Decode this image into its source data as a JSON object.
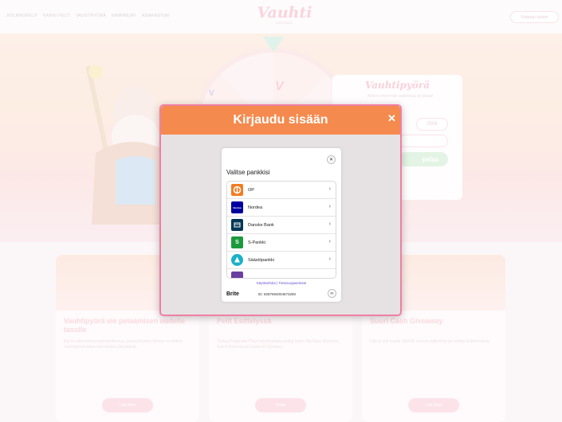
{
  "nav": {
    "links": [
      "KOLIKKOPELIT",
      "KAIKKI PELIT",
      "VAUHTIPYÖRÄ",
      "KAMPANJAT",
      "ASIAKASTUKI"
    ],
    "logo": "Vauhti",
    "logo_sub": "KASINO",
    "login_button": "Kirjaudu sisään"
  },
  "hero": {
    "wheel_symbol": "V",
    "card_title": "Vauhtipyörä",
    "card_subtitle": "Aktivoi enemmän palkintoja tai pelaa!",
    "amount_option": "250€",
    "play_button": "pelaa"
  },
  "promos": [
    {
      "title": "Vauhtipyörä vie pelaamisen uudelle tasolle",
      "text": "Nyt on aika kokea kasinokokemus, jossa jokainen kierros on tärkeä. Vauhtipyörä tekee kierroksista jännittäviä.",
      "button": "Lue lisää"
    },
    {
      "title": "Pelit Esittelyssä",
      "text": "Testaa Pragmatic Playn suosituimpia pelejä kuten Big Bass Bonanza, Sweet Bonanza ja Gates of Olympus.",
      "button": "Pelaa"
    },
    {
      "title": "Suuri Cash Giveaway",
      "text": "Liity ja voit saada 10000€ arvosta palkintoja tai voittaa lisäkierroksia.",
      "button": "Lue lisää"
    }
  ],
  "modal": {
    "title": "Kirjaudu sisään",
    "close_glyph": "✕",
    "bank_heading": "Valitse pankkisi",
    "banks": [
      {
        "name": "OP",
        "logo_color": "#f47b20",
        "logo_text": "OP"
      },
      {
        "name": "Nordea",
        "logo_color": "#0000a0",
        "logo_text": "Nordea"
      },
      {
        "name": "Danske Bank",
        "logo_color": "#003755",
        "logo_text": "D"
      },
      {
        "name": "S-Pankki",
        "logo_color": "#1a9a3c",
        "logo_text": "S"
      },
      {
        "name": "Säästöpankki",
        "logo_color": "#1bb1c8",
        "logo_text": "S"
      },
      {
        "name": "",
        "logo_color": "#6a3fa0",
        "logo_text": ""
      }
    ],
    "links": "Käyttöehdot | Tietosuojaseloste",
    "brand": "Brite",
    "session_id": "ID: 8287594004673260",
    "language": "FI"
  },
  "colors": {
    "modal_header": "#f58a4e",
    "accent_pink": "#f07fa4"
  }
}
